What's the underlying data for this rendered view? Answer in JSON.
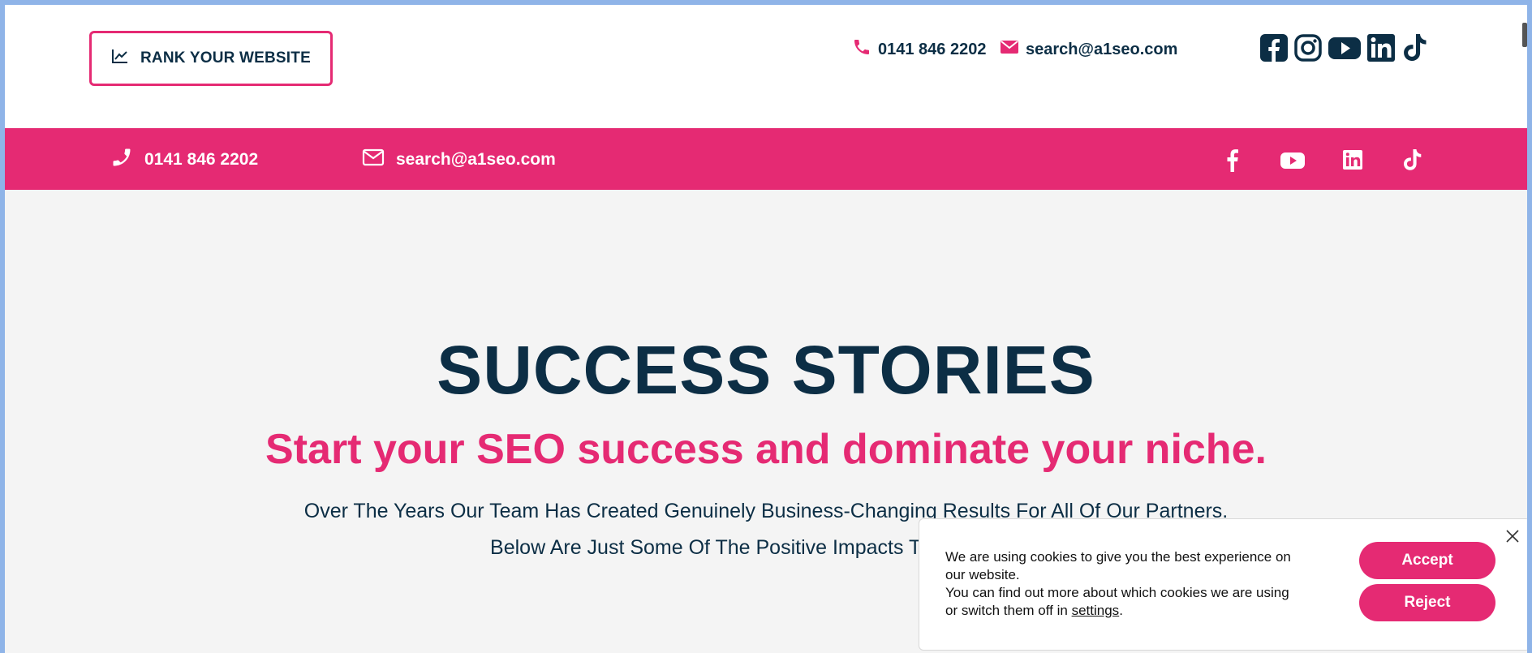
{
  "header": {
    "rank_button": "RANK YOUR WEBSITE",
    "phone": "0141 846 2202",
    "email": "search@a1seo.com",
    "social_icons": [
      "facebook-icon",
      "instagram-icon",
      "youtube-icon",
      "linkedin-icon",
      "tiktok-icon"
    ]
  },
  "pink_bar": {
    "phone": "0141 846 2202",
    "email": "search@a1seo.com",
    "social_icons": [
      "facebook-icon",
      "youtube-icon",
      "linkedin-icon",
      "tiktok-icon"
    ]
  },
  "hero": {
    "title": "SUCCESS STORIES",
    "subtitle": "Start your SEO success and dominate your niche.",
    "line1": "Over The Years Our Team Has Created Genuinely Business-Changing Results For All Of Our Partners.",
    "line2": "Below Are Just Some Of The Positive Impacts That Our Struc"
  },
  "cookie_banner": {
    "text_1": "We are using cookies to give you the best experience on our website.",
    "text_2": "You can find out more about which cookies we are using or switch them off in",
    "settings_link": "settings",
    "period": ".",
    "accept": "Accept",
    "reject": "Reject"
  },
  "colors": {
    "accent": "#e52a73",
    "navy": "#0c2e45",
    "background": "#f4f4f4"
  }
}
